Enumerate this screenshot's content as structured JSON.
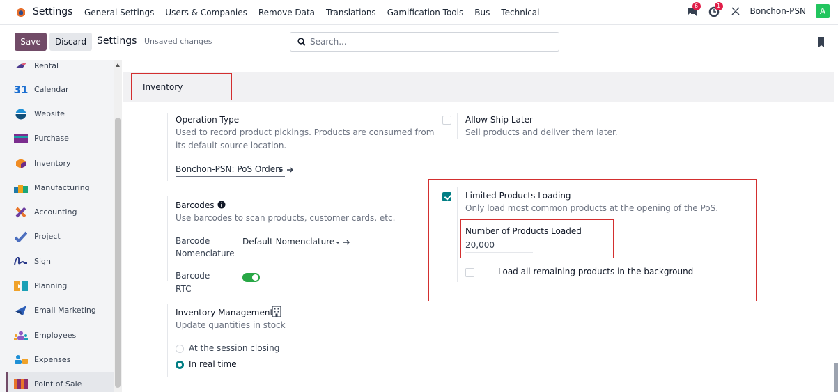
{
  "topbar": {
    "app_name": "Settings",
    "menu": [
      "General Settings",
      "Users & Companies",
      "Remove Data",
      "Translations",
      "Gamification Tools",
      "Bus",
      "Technical"
    ],
    "messages_count": "6",
    "activities_count": "1",
    "company": "Bonchon-PSN",
    "avatar_letter": "A"
  },
  "control_panel": {
    "save_label": "Save",
    "discard_label": "Discard",
    "title": "Settings",
    "status": "Unsaved changes",
    "search_placeholder": "Search..."
  },
  "sidebar": {
    "items": [
      {
        "label": "Rental",
        "icon": "rental-icon"
      },
      {
        "label": "Calendar",
        "icon": "calendar-icon"
      },
      {
        "label": "Website",
        "icon": "website-icon"
      },
      {
        "label": "Purchase",
        "icon": "purchase-icon"
      },
      {
        "label": "Inventory",
        "icon": "inventory-icon"
      },
      {
        "label": "Manufacturing",
        "icon": "manufacturing-icon"
      },
      {
        "label": "Accounting",
        "icon": "accounting-icon"
      },
      {
        "label": "Project",
        "icon": "project-icon"
      },
      {
        "label": "Sign",
        "icon": "sign-icon"
      },
      {
        "label": "Planning",
        "icon": "planning-icon"
      },
      {
        "label": "Email Marketing",
        "icon": "email-marketing-icon"
      },
      {
        "label": "Employees",
        "icon": "employees-icon"
      },
      {
        "label": "Expenses",
        "icon": "expenses-icon"
      },
      {
        "label": "Point of Sale",
        "icon": "point-of-sale-icon"
      }
    ],
    "calendar_number": "31"
  },
  "section": {
    "title": "Inventory",
    "operation_type": {
      "title": "Operation Type",
      "desc_1": "Used to record product pickings. Products are consumed from",
      "desc_2": "its default source location.",
      "value": "Bonchon-PSN: PoS Orders"
    },
    "allow_ship_later": {
      "title": "Allow Ship Later",
      "desc": "Sell products and deliver them later.",
      "checked": false
    },
    "barcodes": {
      "title": "Barcodes",
      "desc": "Use barcodes to scan products, customer cards, etc.",
      "nomenclature_label_1": "Barcode",
      "nomenclature_label_2": "Nomenclature",
      "nomenclature_value": "Default Nomenclature",
      "rtc_label_1": "Barcode",
      "rtc_label_2": "RTC",
      "rtc_on": true
    },
    "limited_loading": {
      "title": "Limited Products Loading",
      "desc": "Only load most common products at the opening of the PoS.",
      "checked": true,
      "number_label": "Number of Products Loaded",
      "number_value": "20,000",
      "background_label": "Load all remaining products in the background",
      "background_checked": false
    },
    "inventory_management": {
      "title": "Inventory Management",
      "desc": "Update quantities in stock",
      "options": [
        "At the session closing",
        "In real time"
      ],
      "selected": "In real time"
    }
  },
  "colors": {
    "brand": "#714b67",
    "accent": "#017e84",
    "toggle": "#28a745",
    "highlight": "#d32f2f"
  }
}
